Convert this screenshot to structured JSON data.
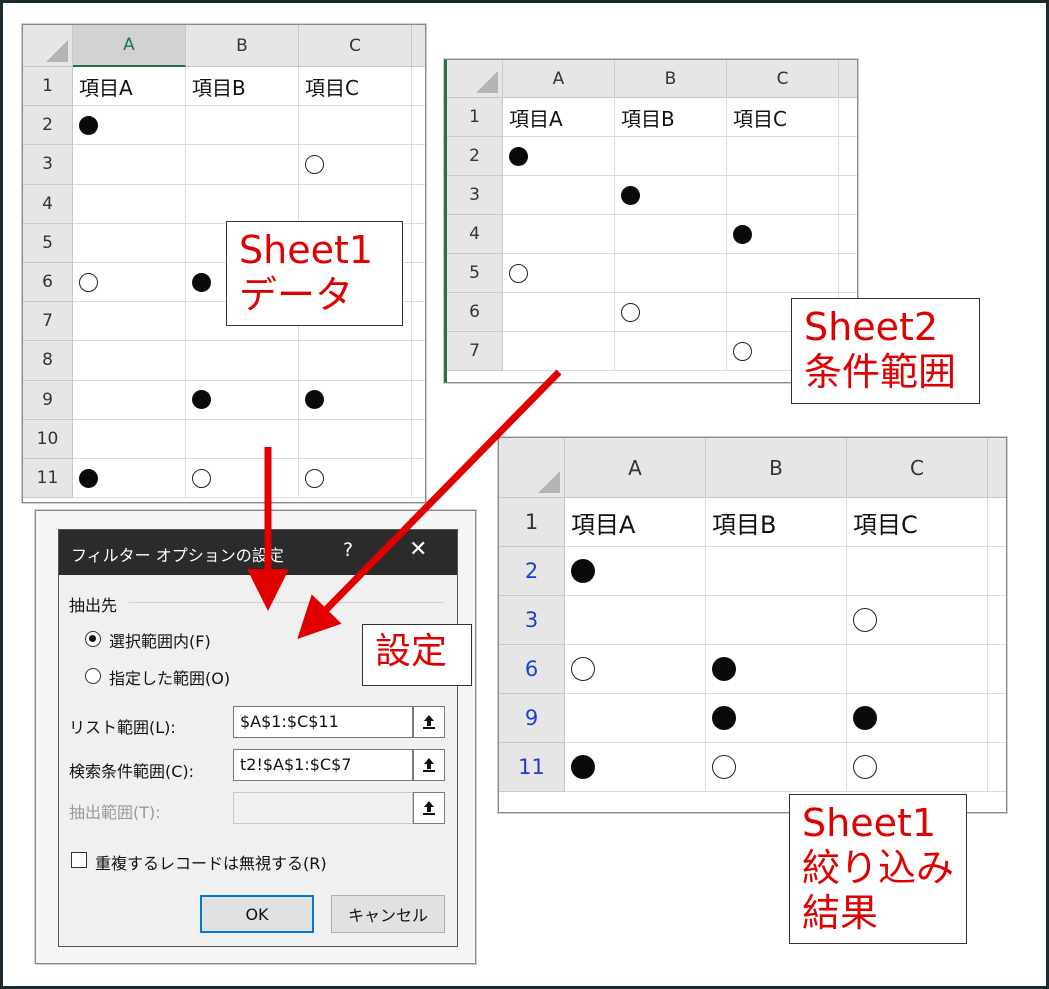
{
  "colors": {
    "accent_red": "#e00000",
    "excel_green": "#217346",
    "row_blue": "#1a3fd6"
  },
  "sheet1": {
    "columns": [
      "A",
      "B",
      "C"
    ],
    "selected_column": "A",
    "rows": [
      "1",
      "2",
      "3",
      "4",
      "5",
      "6",
      "7",
      "8",
      "9",
      "10",
      "11"
    ],
    "headers": [
      "項目A",
      "項目B",
      "項目C"
    ],
    "marks": [
      [
        "",
        "",
        ""
      ],
      [
        "filled",
        "",
        ""
      ],
      [
        "",
        "",
        "open"
      ],
      [
        "",
        "",
        ""
      ],
      [
        "",
        "",
        ""
      ],
      [
        "open",
        "filled",
        ""
      ],
      [
        "",
        "",
        ""
      ],
      [
        "",
        "",
        ""
      ],
      [
        "",
        "filled",
        "filled"
      ],
      [
        "",
        "",
        ""
      ],
      [
        "filled",
        "open",
        "open"
      ]
    ]
  },
  "sheet2": {
    "columns": [
      "A",
      "B",
      "C"
    ],
    "rows": [
      "1",
      "2",
      "3",
      "4",
      "5",
      "6",
      "7"
    ],
    "headers": [
      "項目A",
      "項目B",
      "項目C"
    ],
    "marks": [
      [
        "",
        "",
        ""
      ],
      [
        "filled",
        "",
        ""
      ],
      [
        "",
        "filled",
        ""
      ],
      [
        "",
        "",
        "filled"
      ],
      [
        "open",
        "",
        ""
      ],
      [
        "",
        "open",
        ""
      ],
      [
        "",
        "",
        "open"
      ]
    ]
  },
  "result": {
    "columns": [
      "A",
      "B",
      "C"
    ],
    "rows": [
      "1",
      "2",
      "3",
      "6",
      "9",
      "11"
    ],
    "headers": [
      "項目A",
      "項目B",
      "項目C"
    ],
    "marks": [
      [
        "",
        "",
        ""
      ],
      [
        "filled",
        "",
        ""
      ],
      [
        "",
        "",
        "open"
      ],
      [
        "open",
        "filled",
        ""
      ],
      [
        "",
        "filled",
        "filled"
      ],
      [
        "filled",
        "open",
        "open"
      ]
    ]
  },
  "labels": {
    "sheet1_data": [
      "Sheet1",
      "データ"
    ],
    "sheet2_criteria": [
      "Sheet2",
      "条件範囲"
    ],
    "settings": "設定",
    "sheet1_result": [
      "Sheet1",
      "絞り込み",
      "結果"
    ]
  },
  "dialog": {
    "title": "フィルター オプションの設定",
    "help": "?",
    "close": "✕",
    "group_label": "抽出先",
    "radio_inplace": "選択範囲内(F)",
    "radio_other": "指定した範囲(O)",
    "list_range_label": "リスト範囲(L):",
    "list_range_value": "$A$1:$C$11",
    "criteria_range_label": "検索条件範囲(C):",
    "criteria_range_value": "t2!$A$1:$C$7",
    "copy_to_label": "抽出範囲(T):",
    "copy_to_value": "",
    "unique_label": "重複するレコードは無視する(R)",
    "ok": "OK",
    "cancel": "キャンセル"
  }
}
